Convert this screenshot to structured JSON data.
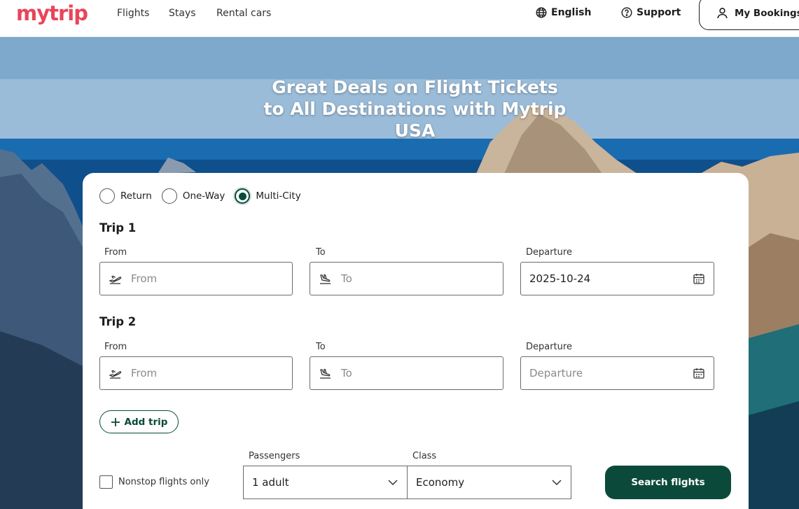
{
  "brand": {
    "logo_text": "mytrip",
    "accent_color": "#e8455a",
    "primary_color": "#0b4a3a"
  },
  "header": {
    "nav": [
      "Flights",
      "Stays",
      "Rental cars"
    ],
    "language": "English",
    "support": "Support",
    "my_bookings": "My Bookings",
    "icons": {
      "language": "globe-icon",
      "support": "question-circle-icon",
      "bookings": "user-icon"
    }
  },
  "hero": {
    "title_line1": "Great Deals on Flight Tickets",
    "title_line2": "to All Destinations with Mytrip",
    "title_line3": "USA"
  },
  "search": {
    "trip_types": [
      {
        "label": "Return",
        "selected": false
      },
      {
        "label": "One-Way",
        "selected": false
      },
      {
        "label": "Multi-City",
        "selected": true
      }
    ],
    "trips": [
      {
        "heading": "Trip 1",
        "from_label": "From",
        "from_placeholder": "From",
        "to_label": "To",
        "to_placeholder": "To",
        "departure_label": "Departure",
        "departure_value": "2025-10-24"
      },
      {
        "heading": "Trip 2",
        "from_label": "From",
        "from_placeholder": "From",
        "to_label": "To",
        "to_placeholder": "To",
        "departure_label": "Departure",
        "departure_placeholder": "Departure"
      }
    ],
    "add_trip": "Add trip",
    "nonstop_label": "Nonstop flights only",
    "nonstop_checked": false,
    "passengers_label": "Passengers",
    "passengers_value": "1 adult",
    "class_label": "Class",
    "class_value": "Economy",
    "search_button": "Search flights"
  }
}
